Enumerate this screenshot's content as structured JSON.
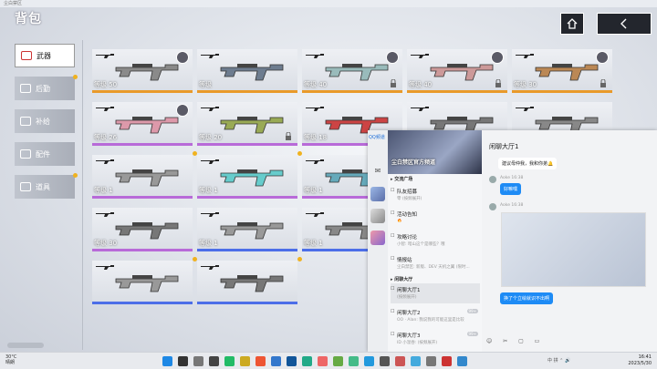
{
  "window": {
    "title": "尘白禁区"
  },
  "header": {
    "title": "背包",
    "home_icon": "home-icon",
    "back_icon": "back-arrow-icon"
  },
  "sidebar": {
    "items": [
      {
        "label": "武器",
        "active": true,
        "icon": "weapon-icon",
        "dot": false
      },
      {
        "label": "后勤",
        "active": false,
        "icon": "logistics-icon",
        "dot": true
      },
      {
        "label": "补给",
        "active": false,
        "icon": "supply-icon",
        "dot": false
      },
      {
        "label": "配件",
        "active": false,
        "icon": "parts-icon",
        "dot": false
      },
      {
        "label": "道具",
        "active": false,
        "icon": "item-icon",
        "dot": true
      }
    ]
  },
  "weapons": [
    {
      "level": "等级 50",
      "color": "#e99a2a",
      "avatar": true,
      "lock": false
    },
    {
      "level": "等级",
      "color": "#e99a2a",
      "avatar": false,
      "lock": false
    },
    {
      "level": "等级 40",
      "color": "#e99a2a",
      "avatar": true,
      "lock": true
    },
    {
      "level": "等级 40",
      "color": "#e99a2a",
      "avatar": true,
      "lock": true
    },
    {
      "level": "等级 30",
      "color": "#e99a2a",
      "avatar": true,
      "lock": true
    },
    {
      "level": "等级 26",
      "color": "#b86ad8",
      "avatar": true,
      "lock": false
    },
    {
      "level": "等级 20",
      "color": "#b86ad8",
      "avatar": false,
      "lock": true
    },
    {
      "level": "等级 18",
      "color": "#b86ad8",
      "avatar": false,
      "lock": false
    },
    {
      "level": "等级",
      "color": "#b86ad8",
      "avatar": false,
      "lock": false
    },
    {
      "level": "等级",
      "color": "#b86ad8",
      "avatar": false,
      "lock": false
    },
    {
      "level": "等级 1",
      "color": "#b86ad8",
      "avatar": false,
      "lock": false
    },
    {
      "level": "等级 1",
      "color": "#b86ad8",
      "avatar": false,
      "lock": false
    },
    {
      "level": "等级 1",
      "color": "#b86ad8",
      "avatar": false,
      "lock": false
    },
    {
      "level": "等级 1",
      "color": "#b86ad8",
      "avatar": false,
      "lock": false
    },
    {
      "level": "等级 40",
      "color": "#b86ad8",
      "avatar": true,
      "lock": true
    },
    {
      "level": "等级 30",
      "color": "#b86ad8",
      "avatar": false,
      "lock": false
    },
    {
      "level": "等级 1",
      "color": "#4c6ee8",
      "avatar": false,
      "lock": false
    },
    {
      "level": "等级 1",
      "color": "#4c6ee8",
      "avatar": false,
      "lock": false
    },
    {
      "level": "等级 1",
      "color": "#4c6ee8",
      "avatar": false,
      "lock": false
    },
    {
      "level": "",
      "color": "#4c6ee8",
      "avatar": false,
      "lock": false
    },
    {
      "level": "",
      "color": "#4c6ee8",
      "avatar": false,
      "lock": false
    },
    {
      "level": "",
      "color": "#4c6ee8",
      "avatar": false,
      "lock": false
    }
  ],
  "chat": {
    "app_label": "QQ频道",
    "banner_title": "尘白禁区官方频道",
    "section_notice": "▸ 交流广场",
    "section_lobby": "▸ 闲聊大厅",
    "channels": [
      {
        "name": "队友招募",
        "desc": "零 (按频展开)",
        "icon": "☐"
      },
      {
        "name": "活动告知",
        "desc": "🔥",
        "icon": "☐"
      },
      {
        "name": "攻略讨论",
        "desc": "小智: 暗山这个是哪些？哦",
        "icon": "☐"
      },
      {
        "name": "情报站",
        "desc": "尘白禁区: 新版、DEV 天机之翼 (限时...",
        "icon": "☐"
      }
    ],
    "lobby": [
      {
        "name": "闲聊大厅1",
        "desc": "(按频展开)",
        "badge": "",
        "selected": true
      },
      {
        "name": "闲聊大厅2",
        "desc": "OO · Alan: 我说我的可能这里是比较",
        "badge": "99+",
        "selected": false
      },
      {
        "name": "闲聊大厅3",
        "desc": "ID 小温吞: (按频展开)",
        "badge": "99+",
        "selected": false
      }
    ],
    "main_title": "闲聊大厅1",
    "messages": [
      {
        "text": "建议母仲我，我和你弟🔔",
        "type": "w"
      },
      {
        "name": "Aoke 16:38",
        "text": "好嘛嘿",
        "type": "b"
      },
      {
        "name": "Aoke 16:38",
        "text": "",
        "type": "img"
      },
      {
        "text": "换了个立绘就识不出啊",
        "type": "b"
      }
    ],
    "tools": "☺ ✂ ▢ ▭"
  },
  "taskbar": {
    "weather_temp": "30°C",
    "weather_desc": "晴朗",
    "time": "16:41",
    "date": "2023/5/30",
    "tray": "中 拼 ⌃ 🔊"
  }
}
